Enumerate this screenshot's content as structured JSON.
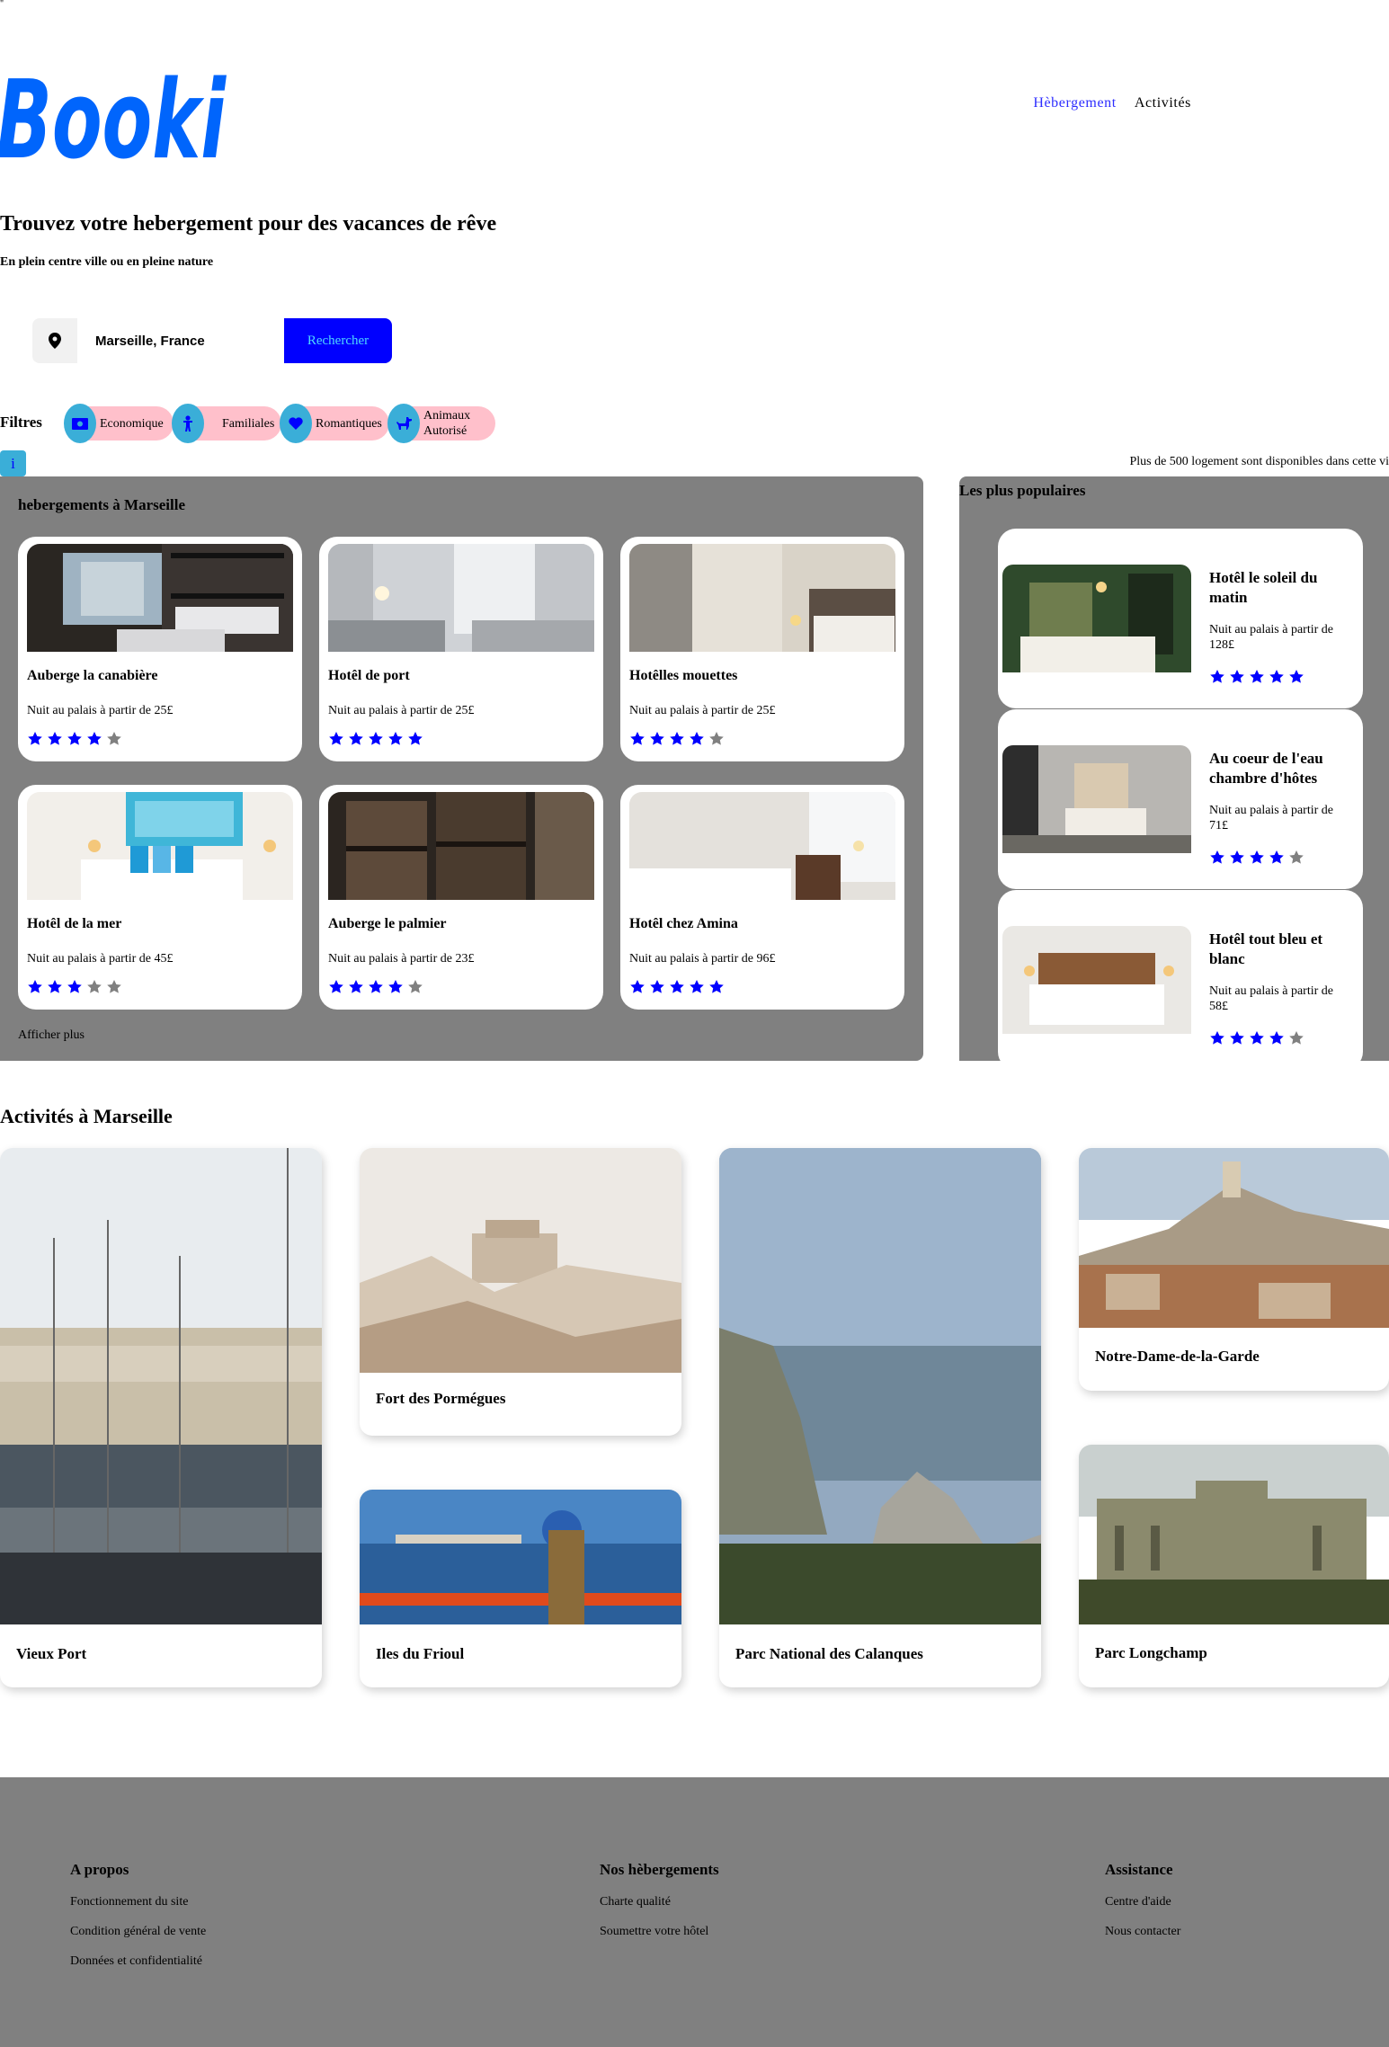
{
  "quote_mark": "\"",
  "header": {
    "logo_text": "Booki",
    "nav": [
      {
        "label": "Hèbergement",
        "active": true
      },
      {
        "label": "Activités",
        "active": false
      }
    ]
  },
  "hero": {
    "title": "Trouvez votre hebergement pour des vacances de rêve",
    "subtitle": "En plein centre ville ou en pleine nature"
  },
  "search": {
    "value": "Marseille, France",
    "button": "Rechercher"
  },
  "filters": {
    "label": "Filtres",
    "chips": [
      {
        "label": "Economique",
        "icon": "money-icon"
      },
      {
        "label": "Familiales",
        "icon": "child-icon"
      },
      {
        "label": "Romantiques",
        "icon": "heart-icon"
      },
      {
        "label": "Animaux Autorisé",
        "icon": "dog-icon"
      }
    ]
  },
  "info": {
    "badge": "i",
    "text": "Plus de 500 logement sont disponibles dans cette vi"
  },
  "listings": {
    "title": "hebergements à Marseille",
    "show_more": "Afficher plus",
    "items": [
      {
        "name": "Auberge la canabière",
        "price": "Nuit au palais à partir de 25£",
        "rating": 4
      },
      {
        "name": "Hotêl de port",
        "price": "Nuit au palais à partir de 25£",
        "rating": 5
      },
      {
        "name": "Hotêlles mouettes",
        "price": "Nuit au palais à partir de 25£",
        "rating": 4
      },
      {
        "name": "Hotêl de la mer",
        "price": "Nuit au palais à partir de 45£",
        "rating": 3
      },
      {
        "name": "Auberge le palmier",
        "price": "Nuit au palais à partir de 23£",
        "rating": 4
      },
      {
        "name": "Hotêl chez Amina",
        "price": "Nuit au palais à partir de 96£",
        "rating": 5
      }
    ]
  },
  "popular": {
    "title": "Les plus populaires",
    "items": [
      {
        "name": "Hotêl le soleil du matin",
        "price": "Nuit au palais à partir de 128£",
        "rating": 5
      },
      {
        "name": "Au coeur de l'eau chambre d'hôtes",
        "price": "Nuit au palais à partir de 71£",
        "rating": 4
      },
      {
        "name": "Hotêl tout bleu et blanc",
        "price": "Nuit au palais à partir de 58£",
        "rating": 4
      }
    ]
  },
  "activities": {
    "title": "Activités à Marseille",
    "items": [
      {
        "name": "Vieux Port"
      },
      {
        "name": "Fort des Pormégues"
      },
      {
        "name": "Iles du Frioul"
      },
      {
        "name": "Parc National des Calanques"
      },
      {
        "name": "Notre-Dame-de-la-Garde"
      },
      {
        "name": "Parc Longchamp"
      }
    ]
  },
  "footer": {
    "columns": [
      {
        "title": "A propos",
        "links": [
          "Fonctionnement du site",
          "Condition général de vente",
          "Données et confidentialité"
        ]
      },
      {
        "title": "Nos hèbergements",
        "links": [
          "Charte qualité",
          "Soumettre votre hôtel"
        ]
      },
      {
        "title": "Assistance",
        "links": [
          "Centre d'aide",
          "Nous contacter"
        ]
      }
    ]
  },
  "colors": {
    "brand_blue": "#0065fc",
    "star_on": "#0000ff",
    "star_off": "#808080",
    "chip_bg": "#ffc0cb",
    "chip_icon": "#3aaed8",
    "panel_bg": "#808080"
  }
}
